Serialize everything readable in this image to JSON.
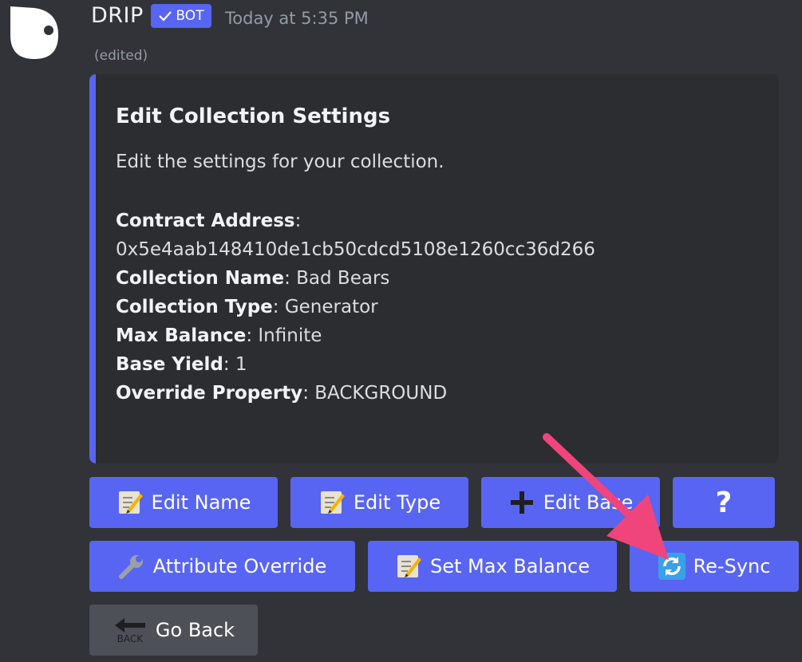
{
  "message": {
    "author": "DRIP",
    "badge": "BOT",
    "timestamp": "Today at 5:35 PM",
    "edited": "(edited)"
  },
  "embed": {
    "title": "Edit Collection Settings",
    "description": "Edit the settings for your collection.",
    "fields": [
      {
        "label": "Contract Address",
        "value": "0x5e4aab148410de1cb50cdcd5108e1260cc36d266"
      },
      {
        "label": "Collection Name",
        "value": "Bad Bears"
      },
      {
        "label": "Collection Type",
        "value": "Generator"
      },
      {
        "label": "Max Balance",
        "value": "Infinite"
      },
      {
        "label": "Base Yield",
        "value": "1"
      },
      {
        "label": "Override Property",
        "value": "BACKGROUND"
      }
    ],
    "accent_color": "#5865f2"
  },
  "buttons": {
    "edit_name": "Edit Name",
    "edit_type": "Edit Type",
    "edit_base": "Edit Base",
    "help": "?",
    "attribute_override": "Attribute Override",
    "set_max_balance": "Set Max Balance",
    "resync": "Re-Sync",
    "go_back": "Go Back",
    "back_icon_text": "BACK"
  },
  "icons": {
    "memo": "memo-icon",
    "plus": "plus-icon",
    "wrench": "wrench-icon",
    "refresh": "refresh-icon",
    "back": "back-arrow-icon"
  },
  "colors": {
    "blurple": "#5865f2",
    "annotation_arrow": "#f0457c"
  }
}
